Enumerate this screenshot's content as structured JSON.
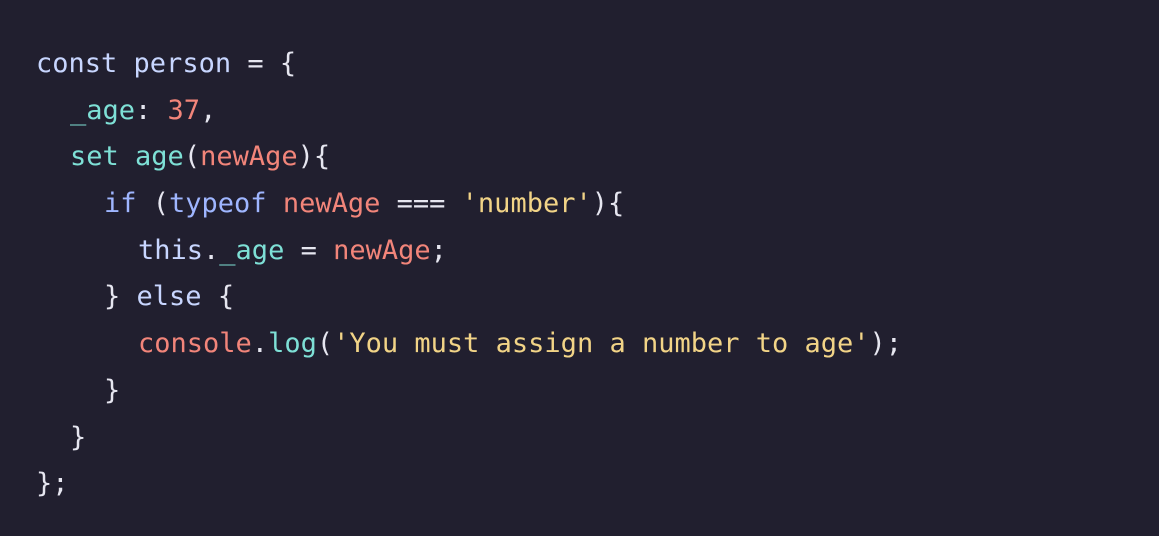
{
  "colors": {
    "background": "#211f2f",
    "text": "#e6e6f0",
    "keyword": "#c8d6ff",
    "property": "#7ee0d6",
    "parameter_number": "#f2857a",
    "string": "#f2d487"
  },
  "code": {
    "l1": {
      "kw": "const",
      "name": "person",
      "op": " = ",
      "brace": "{"
    },
    "l2": {
      "prop": "_age",
      "colon": ": ",
      "num": "37",
      "comma": ","
    },
    "l3": {
      "kw": "set",
      "method": "age",
      "open": "(",
      "param": "newAge",
      "close": "){"
    },
    "l4": {
      "kw": "if",
      "open": " (",
      "typeof": "typeof",
      "param": "newAge",
      "op": " === ",
      "str": "'number'",
      "close": "){"
    },
    "l5": {
      "this": "this",
      "dot": ".",
      "prop": "_age",
      "op": " = ",
      "param": "newAge",
      "semi": ";"
    },
    "l6": {
      "close": "}",
      "kw": "else",
      "open": "{"
    },
    "l7": {
      "obj": "console",
      "dot": ".",
      "method": "log",
      "open": "(",
      "str": "'You must assign a number to age'",
      "close": ");"
    },
    "l8": {
      "close": "}"
    },
    "l9": {
      "close": "}"
    },
    "l10": {
      "close": "};"
    }
  }
}
